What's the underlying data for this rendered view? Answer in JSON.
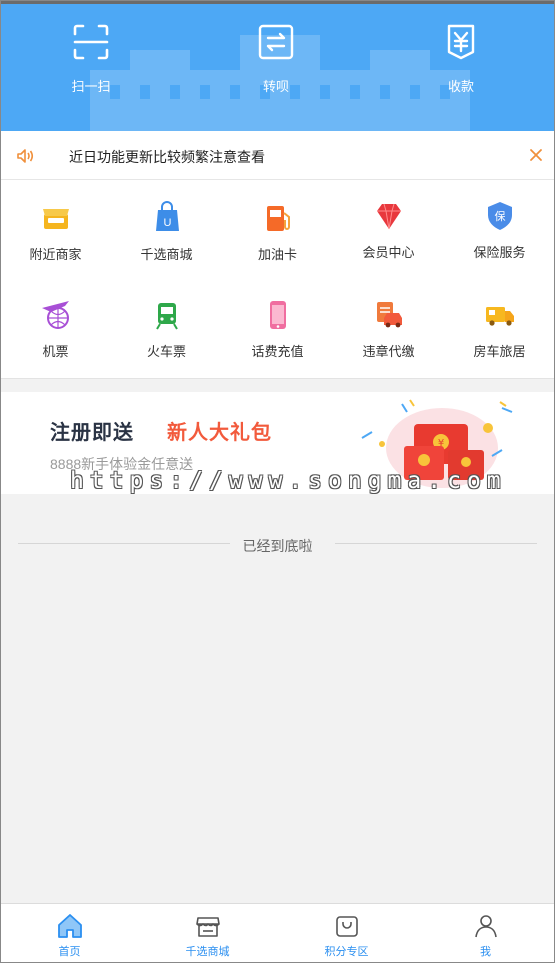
{
  "header": {
    "actions": [
      {
        "label": "扫一扫",
        "icon": "scan-icon"
      },
      {
        "label": "转呗",
        "icon": "transfer-icon"
      },
      {
        "label": "收款",
        "icon": "receive-payment-icon"
      }
    ]
  },
  "notice": {
    "text": "近日功能更新比较频繁注意查看",
    "icon": "speaker-icon",
    "close_icon": "close-icon"
  },
  "services": [
    {
      "label": "附近商家",
      "icon": "shop-icon"
    },
    {
      "label": "千选商城",
      "icon": "shopping-bag-icon"
    },
    {
      "label": "加油卡",
      "icon": "gas-station-icon"
    },
    {
      "label": "会员中心",
      "icon": "diamond-icon"
    },
    {
      "label": "保险服务",
      "icon": "shield-icon"
    },
    {
      "label": "机票",
      "icon": "airplane-icon"
    },
    {
      "label": "火车票",
      "icon": "train-icon"
    },
    {
      "label": "话费充值",
      "icon": "phone-icon"
    },
    {
      "label": "违章代缴",
      "icon": "car-ticket-icon"
    },
    {
      "label": "房车旅居",
      "icon": "rv-truck-icon"
    }
  ],
  "banner": {
    "title_part1": "注册即送",
    "title_part2": "新人大礼包",
    "subtitle": "8888新手体验金任意送"
  },
  "watermark": "https://www.songma.com",
  "end_text": "已经到底啦",
  "tabbar": {
    "tabs": [
      {
        "label": "首页",
        "icon": "home-icon",
        "active": true
      },
      {
        "label": "千选商城",
        "icon": "store-icon",
        "active": false
      },
      {
        "label": "积分专区",
        "icon": "points-bag-icon",
        "active": false
      },
      {
        "label": "我",
        "icon": "user-icon",
        "active": false
      }
    ]
  },
  "colors": {
    "header_bg": "#4da8f5",
    "accent": "#2b8ff0",
    "banner_highlight": "#f25a3c",
    "notice_icon": "#f0903c"
  }
}
